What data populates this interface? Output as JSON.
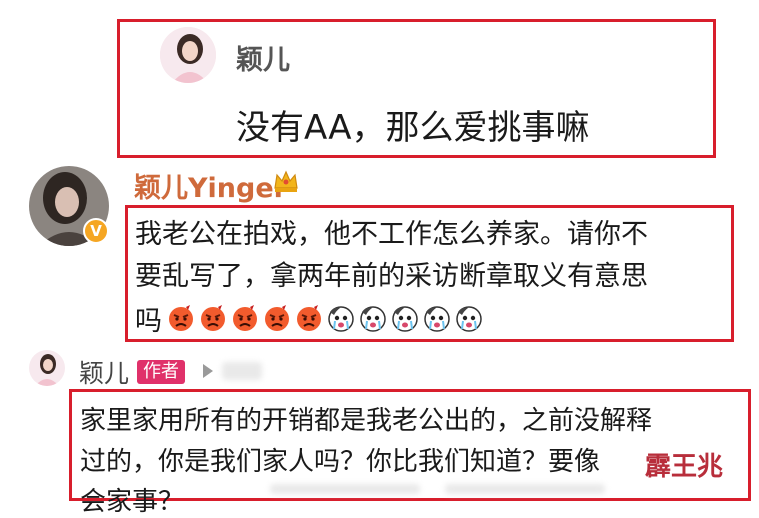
{
  "comment1": {
    "username": "颖儿",
    "text": "没有AA，那么爱挑事嘛"
  },
  "comment2": {
    "username": "颖儿Yinger",
    "crown_icon": "crown-icon",
    "verified_icon": "verified-v-icon",
    "line1": "我老公在拍戏，他不工作怎么养家。请你不",
    "line2": "要乱写了，拿两年前的采访断章取义有意思",
    "line3": "吗",
    "emojis": [
      "angry",
      "angry",
      "angry",
      "angry",
      "angry",
      "cry",
      "cry",
      "cry",
      "cry",
      "cry"
    ]
  },
  "comment3": {
    "username": "颖儿",
    "author_badge": "作者",
    "arrow_icon": "reply-arrow-icon",
    "line1": "家里家用所有的开销都是我老公出的，之前没解释",
    "line2": "过的，你是我们家人吗？你比我们知道？要像",
    "line3": "会家事？"
  },
  "watermark": "霹王兆",
  "colors": {
    "highlight_border": "#d81e2c",
    "author_badge": "#e0316a",
    "username": "#555555"
  }
}
